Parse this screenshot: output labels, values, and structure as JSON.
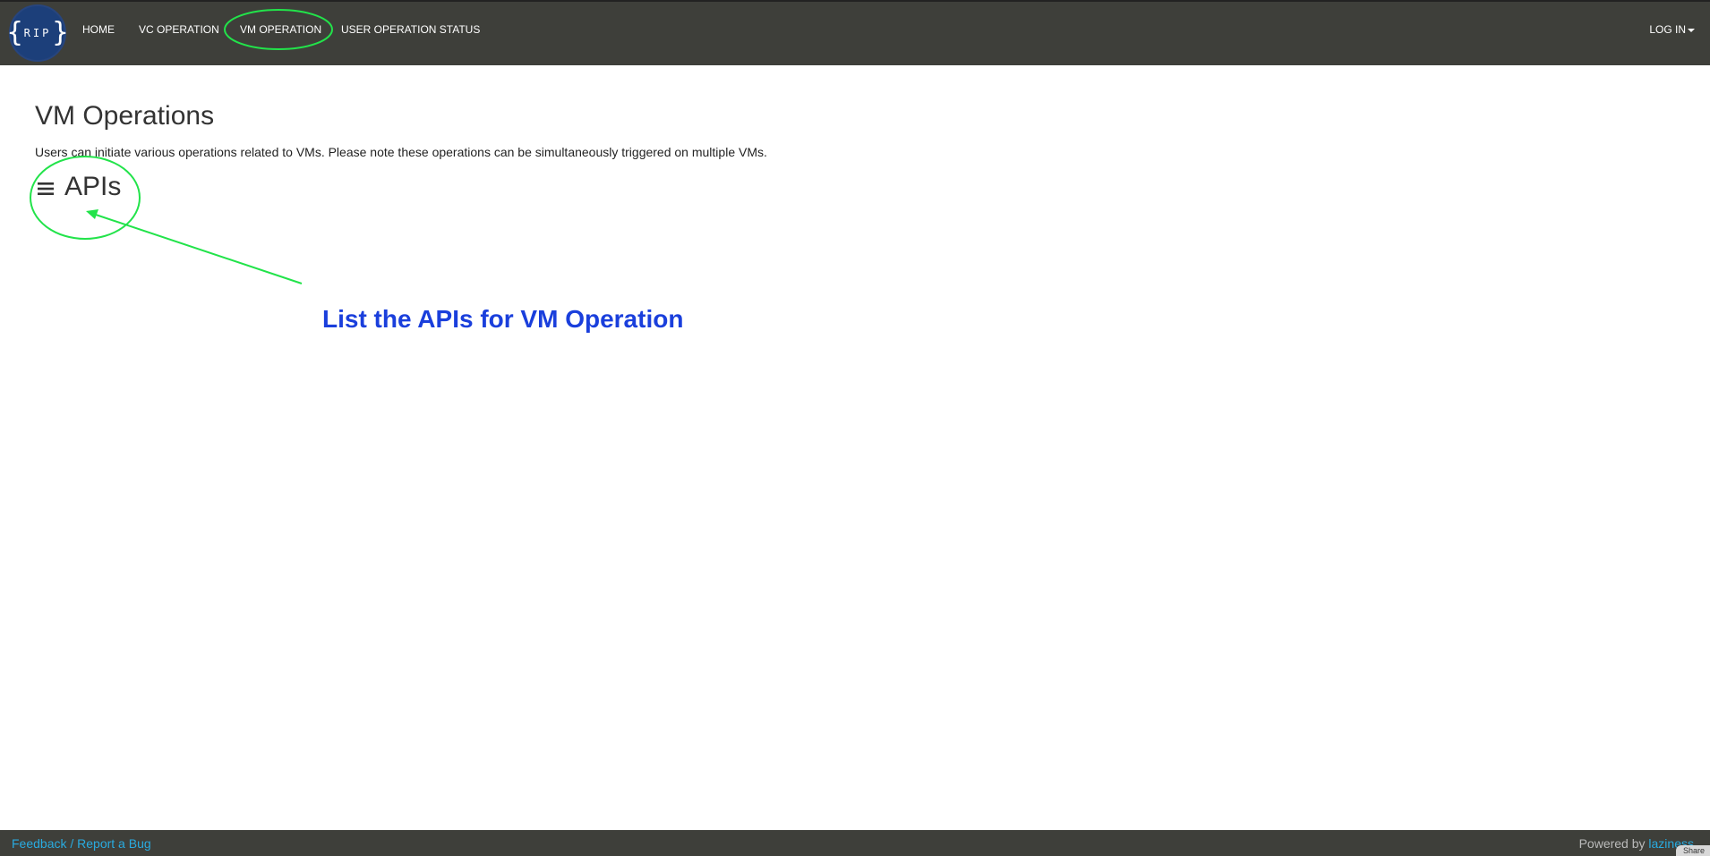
{
  "navbar": {
    "logo_text": "RIP",
    "items": [
      {
        "label": "HOME"
      },
      {
        "label": "VC OPERATION"
      },
      {
        "label": "VM OPERATION"
      },
      {
        "label": "USER OPERATION STATUS"
      }
    ],
    "login_label": "LOG IN"
  },
  "main": {
    "title": "VM Operations",
    "description": "Users can initiate various operations related to VMs. Please note these operations can be simultaneously triggered on multiple VMs.",
    "apis_label": "APIs"
  },
  "annotation": {
    "text": "List the APIs for VM Operation",
    "color": "#1a3fdc",
    "highlight_color": "#22e34a"
  },
  "footer": {
    "feedback_label": "Feedback / Report a Bug",
    "powered_by_text": "Powered by",
    "powered_by_brand": "laziness",
    "share_label": "Share"
  },
  "colors": {
    "navbar_bg": "#3e3f3a",
    "link": "#29abe0",
    "logo_bg": "#1c3f7a"
  }
}
